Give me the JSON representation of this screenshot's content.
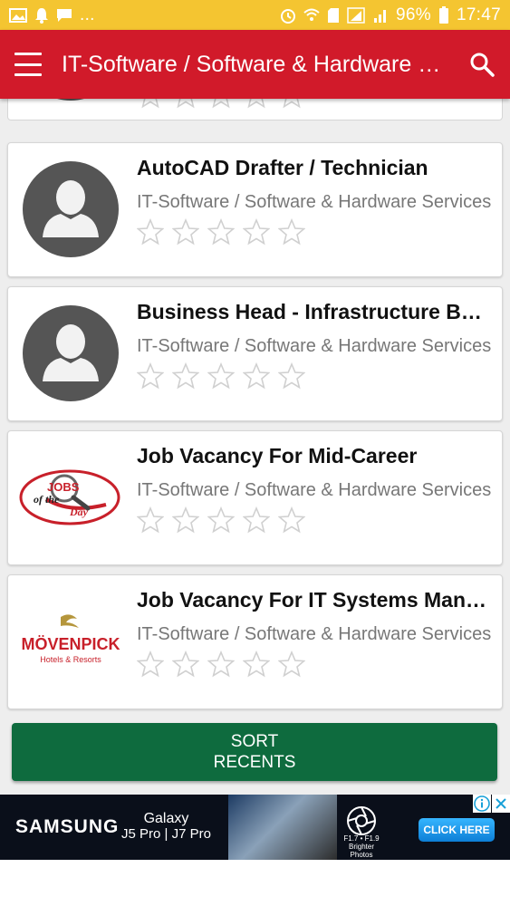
{
  "status_bar": {
    "battery_percent": "96%",
    "time": "17:47",
    "notification_dots": "..."
  },
  "app_bar": {
    "title": "IT-Software / Software & Hardware Services",
    "menu_icon": "hamburger-menu-icon",
    "search_icon": "search-icon"
  },
  "jobs": [
    {
      "title": "AutoCAD Drafter / Technician",
      "category": "IT-Software / Software & Hardware Services",
      "thumb": "default-avatar",
      "rating": 0
    },
    {
      "title": "Business Head - Infrastructure Business",
      "category": "IT-Software / Software & Hardware Services",
      "thumb": "default-avatar",
      "rating": 0
    },
    {
      "title": "Job Vacancy For Mid-Career",
      "category": "IT-Software / Software & Hardware Services",
      "thumb": "jobs-of-the-day-logo",
      "rating": 0,
      "logo_text": [
        "JOBS",
        "of the",
        "Day"
      ]
    },
    {
      "title": "Job Vacancy For IT Systems Manager",
      "category": "IT-Software / Software & Hardware Services",
      "thumb": "movenpick-logo",
      "rating": 0,
      "logo_text": [
        "MÖVENPICK",
        "Hotels & Resorts"
      ]
    }
  ],
  "sort_button": {
    "line1": "SORT",
    "line2": "RECENTS"
  },
  "ad": {
    "brand": "SAMSUNG",
    "model_line1": "Galaxy",
    "model_line2": "J5 Pro | J7 Pro",
    "aperture_text": "F1.7 • F1.9",
    "tagline": "Brighter Photos",
    "cta": "CLICK HERE"
  },
  "colors": {
    "status_bar": "#f4c531",
    "app_bar": "#d11a2a",
    "sort_button": "#0e6b3e",
    "avatar_bg": "#555555"
  }
}
